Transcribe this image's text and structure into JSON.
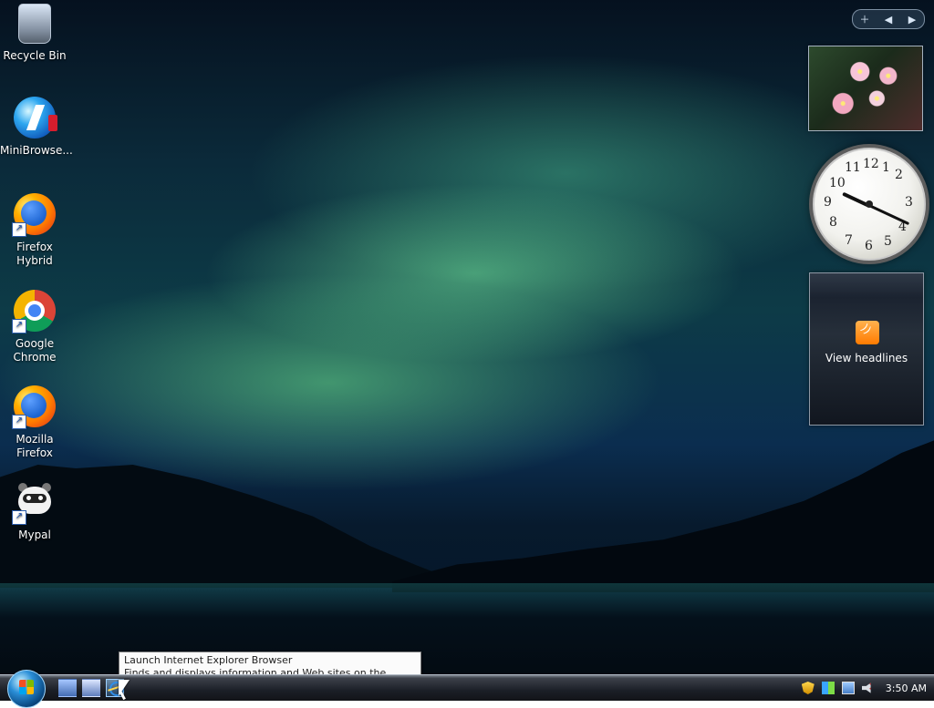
{
  "desktop": {
    "icons": [
      {
        "label": "Recycle Bin"
      },
      {
        "label": "MiniBrowse..."
      },
      {
        "label": "Firefox Hybrid"
      },
      {
        "label": "Google Chrome"
      },
      {
        "label": "Mozilla Firefox"
      },
      {
        "label": "Mypal"
      }
    ]
  },
  "gadgets": {
    "headlines_label": "View headlines"
  },
  "tooltip": {
    "title": "Launch Internet Explorer Browser",
    "text": "Finds and displays information and Web sites on the Internet."
  },
  "taskbar": {
    "time": "3:50 AM"
  },
  "icons": {
    "recycle": "recycle-bin-icon",
    "minibrowser": "minibrowser-icon",
    "firefox": "firefox-icon",
    "chrome": "chrome-icon",
    "mypal": "mypal-icon",
    "ie": "internet-explorer-icon"
  }
}
